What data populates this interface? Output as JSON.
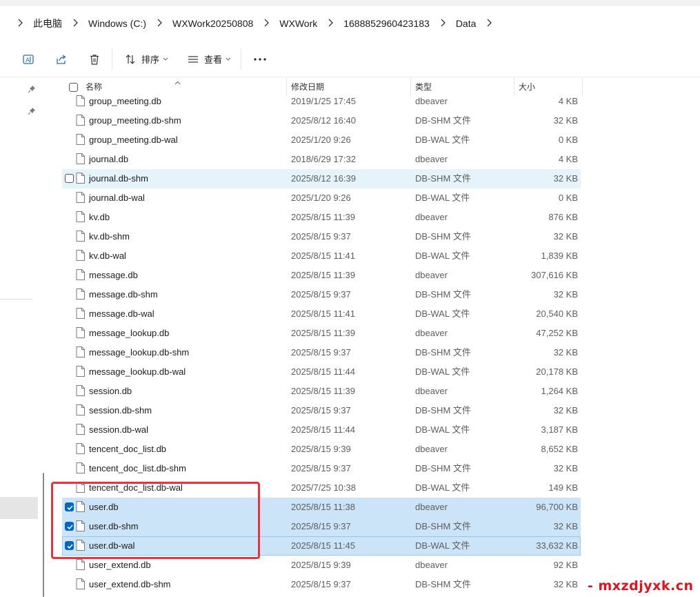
{
  "breadcrumb": [
    "此电脑",
    "Windows (C:)",
    "WXWork20250808",
    "WXWork",
    "1688852960423183",
    "Data"
  ],
  "icons": {
    "back": "chevron-right-icon",
    "copy_path": "text-icon",
    "share": "share-icon",
    "delete": "trash-icon",
    "sort": "sort-icon",
    "view": "view-icon",
    "more": "more-icon",
    "pin": "pin-icon",
    "file": "file-icon"
  },
  "toolbar": {
    "sort_label": "排序",
    "view_label": "查看",
    "more_label": "···"
  },
  "columns": {
    "name": "名称",
    "date": "修改日期",
    "type": "类型",
    "size": "大小"
  },
  "colors": {
    "selection": "#cce4f7",
    "hover": "#e5f3fb",
    "checkbox": "#0067c0",
    "highlight_box": "#e8333f",
    "watermark": "#e0121b"
  },
  "files": [
    {
      "name": "group_meeting.db",
      "date": "2019/1/25 17:45",
      "type": "dbeaver",
      "size": "4 KB",
      "state": "normal"
    },
    {
      "name": "group_meeting.db-shm",
      "date": "2025/8/12 16:40",
      "type": "DB-SHM 文件",
      "size": "32 KB",
      "state": "normal"
    },
    {
      "name": "group_meeting.db-wal",
      "date": "2025/1/20 9:26",
      "type": "DB-WAL 文件",
      "size": "0 KB",
      "state": "normal"
    },
    {
      "name": "journal.db",
      "date": "2018/6/29 17:32",
      "type": "dbeaver",
      "size": "4 KB",
      "state": "normal"
    },
    {
      "name": "journal.db-shm",
      "date": "2025/8/12 16:39",
      "type": "DB-SHM 文件",
      "size": "32 KB",
      "state": "hover"
    },
    {
      "name": "journal.db-wal",
      "date": "2025/1/20 9:26",
      "type": "DB-WAL 文件",
      "size": "0 KB",
      "state": "normal"
    },
    {
      "name": "kv.db",
      "date": "2025/8/15 11:39",
      "type": "dbeaver",
      "size": "876 KB",
      "state": "normal"
    },
    {
      "name": "kv.db-shm",
      "date": "2025/8/15 9:37",
      "type": "DB-SHM 文件",
      "size": "32 KB",
      "state": "normal"
    },
    {
      "name": "kv.db-wal",
      "date": "2025/8/15 11:41",
      "type": "DB-WAL 文件",
      "size": "1,839 KB",
      "state": "normal"
    },
    {
      "name": "message.db",
      "date": "2025/8/15 11:39",
      "type": "dbeaver",
      "size": "307,616 KB",
      "state": "normal"
    },
    {
      "name": "message.db-shm",
      "date": "2025/8/15 9:37",
      "type": "DB-SHM 文件",
      "size": "32 KB",
      "state": "normal"
    },
    {
      "name": "message.db-wal",
      "date": "2025/8/15 11:41",
      "type": "DB-WAL 文件",
      "size": "20,540 KB",
      "state": "normal"
    },
    {
      "name": "message_lookup.db",
      "date": "2025/8/15 11:39",
      "type": "dbeaver",
      "size": "47,252 KB",
      "state": "normal"
    },
    {
      "name": "message_lookup.db-shm",
      "date": "2025/8/15 9:37",
      "type": "DB-SHM 文件",
      "size": "32 KB",
      "state": "normal"
    },
    {
      "name": "message_lookup.db-wal",
      "date": "2025/8/15 11:44",
      "type": "DB-WAL 文件",
      "size": "20,178 KB",
      "state": "normal"
    },
    {
      "name": "session.db",
      "date": "2025/8/15 11:39",
      "type": "dbeaver",
      "size": "1,264 KB",
      "state": "normal"
    },
    {
      "name": "session.db-shm",
      "date": "2025/8/15 9:37",
      "type": "DB-SHM 文件",
      "size": "32 KB",
      "state": "normal"
    },
    {
      "name": "session.db-wal",
      "date": "2025/8/15 11:44",
      "type": "DB-WAL 文件",
      "size": "3,187 KB",
      "state": "normal"
    },
    {
      "name": "tencent_doc_list.db",
      "date": "2025/8/15 9:39",
      "type": "dbeaver",
      "size": "8,652 KB",
      "state": "normal"
    },
    {
      "name": "tencent_doc_list.db-shm",
      "date": "2025/8/15 9:37",
      "type": "DB-SHM 文件",
      "size": "32 KB",
      "state": "normal"
    },
    {
      "name": "tencent_doc_list.db-wal",
      "date": "2025/7/25 10:38",
      "type": "DB-WAL 文件",
      "size": "149 KB",
      "state": "normal"
    },
    {
      "name": "user.db",
      "date": "2025/8/15 11:38",
      "type": "dbeaver",
      "size": "96,700 KB",
      "state": "selected"
    },
    {
      "name": "user.db-shm",
      "date": "2025/8/15 9:37",
      "type": "DB-SHM 文件",
      "size": "32 KB",
      "state": "selected"
    },
    {
      "name": "user.db-wal",
      "date": "2025/8/15 11:45",
      "type": "DB-WAL 文件",
      "size": "33,632 KB",
      "state": "focused"
    },
    {
      "name": "user_extend.db",
      "date": "2025/8/15 9:39",
      "type": "dbeaver",
      "size": "92 KB",
      "state": "normal"
    },
    {
      "name": "user_extend.db-shm",
      "date": "2025/8/15 9:37",
      "type": "DB-SHM 文件",
      "size": "32 KB",
      "state": "normal"
    }
  ],
  "watermark": "-   mxzdjyxk.cn"
}
